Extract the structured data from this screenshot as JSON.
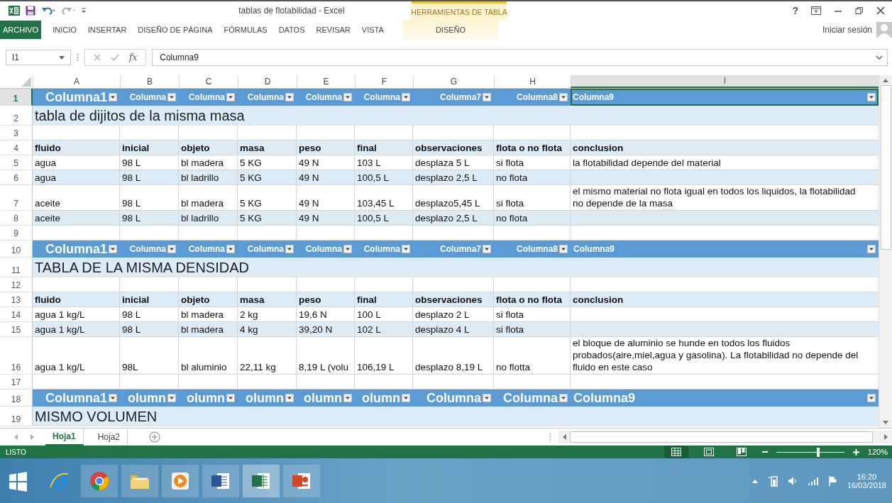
{
  "window": {
    "title": "tablas de flotabilidad - Excel",
    "help": "?"
  },
  "ribbon": {
    "tabs": [
      {
        "label": "ARCHIVO",
        "kind": "file",
        "selected": false
      },
      {
        "label": "INICIO",
        "kind": "tab",
        "selected": false
      },
      {
        "label": "INSERTAR",
        "kind": "tab",
        "selected": false
      },
      {
        "label": "DISEÑO DE PÁGINA",
        "kind": "tab",
        "selected": false
      },
      {
        "label": "FÓRMULAS",
        "kind": "tab",
        "selected": false
      },
      {
        "label": "DATOS",
        "kind": "tab",
        "selected": false
      },
      {
        "label": "REVISAR",
        "kind": "tab",
        "selected": false
      },
      {
        "label": "VISTA",
        "kind": "tab",
        "selected": false
      }
    ],
    "context": {
      "group": "HERRAMIENTAS DE TABLA",
      "tabs": [
        {
          "label": "DISEÑO",
          "selected": false
        }
      ]
    },
    "sign_in": "Iniciar sesión"
  },
  "formula_bar": {
    "name_box": "I1",
    "function_label": "fx",
    "value": "Columna9"
  },
  "columns": [
    {
      "label": "A",
      "selected": false
    },
    {
      "label": "B",
      "selected": false
    },
    {
      "label": "C",
      "selected": false
    },
    {
      "label": "D",
      "selected": false
    },
    {
      "label": "E",
      "selected": false
    },
    {
      "label": "F",
      "selected": false
    },
    {
      "label": "G",
      "selected": false
    },
    {
      "label": "H",
      "selected": false
    },
    {
      "label": "I",
      "selected": true
    }
  ],
  "rows": [
    {
      "number": "1",
      "selected": true,
      "kind": "header",
      "cells": [
        {
          "text": "Columna1",
          "big": true
        },
        {
          "text": "Columna",
          "big": false
        },
        {
          "text": "Columna",
          "big": false
        },
        {
          "text": "Columna",
          "big": false
        },
        {
          "text": "Columna",
          "big": false
        },
        {
          "text": "Columna",
          "big": false
        },
        {
          "text": "Columna7",
          "big": false
        },
        {
          "text": "Columna8",
          "big": false
        },
        {
          "text": "Columna9",
          "big": false
        }
      ]
    },
    {
      "number": "2",
      "selected": false,
      "kind": "title",
      "band": true,
      "text": "tabla de dijitos de la misma masa"
    },
    {
      "number": "3",
      "selected": false,
      "kind": "data",
      "band": false
    },
    {
      "number": "4",
      "selected": false,
      "kind": "data",
      "band": true,
      "bold": true,
      "cells": {
        "A": "fluido",
        "B": "inicial",
        "C": "objeto",
        "D": "masa",
        "E": "peso",
        "F": "final",
        "G": "observaciones",
        "H": "flota o no flota",
        "I": "conclusion"
      }
    },
    {
      "number": "5",
      "selected": false,
      "kind": "data",
      "band": false,
      "bold": false,
      "cells": {
        "A": "agua",
        "B": "98 L",
        "C": "bl madera",
        "D": "5 KG",
        "E": "49 N",
        "F": "103 L",
        "G": "desplaza 5 L",
        "H": "si flota",
        "I": "la flotabilidad depende del material"
      }
    },
    {
      "number": "6",
      "selected": false,
      "kind": "data",
      "band": true,
      "bold": false,
      "cells": {
        "A": "agua",
        "B": "98 L",
        "C": "bl ladrillo",
        "D": "5 KG",
        "E": "49 N",
        "F": "100,5 L",
        "G": "desplazo 2,5 L",
        "H": "no flota"
      }
    },
    {
      "number": "7",
      "selected": false,
      "kind": "data",
      "band": false,
      "bold": false,
      "cells": {
        "A": "aceite",
        "B": "98 L",
        "C": "bl madera",
        "D": "5 KG",
        "E": "49 N",
        "F": "103,45 L",
        "G": "desplazo5,45 L",
        "H": "si flota",
        "I": "el mismo material no flota igual en todos los liquidos, la flotabilidad no depende de la masa"
      }
    },
    {
      "number": "8",
      "selected": false,
      "kind": "data",
      "band": true,
      "bold": false,
      "cells": {
        "A": "aceite",
        "B": "98 L",
        "C": "bl ladrillo",
        "D": "5 KG",
        "E": "49 N",
        "F": "100,5 L",
        "G": "desplazo 2,5 L",
        "H": "no flota"
      }
    },
    {
      "number": "9",
      "selected": false,
      "kind": "data",
      "band": false
    },
    {
      "number": "10",
      "selected": false,
      "kind": "header",
      "cells": [
        {
          "text": "Columna1",
          "big": true
        },
        {
          "text": "Columna",
          "big": false
        },
        {
          "text": "Columna",
          "big": false
        },
        {
          "text": "Columna",
          "big": false
        },
        {
          "text": "Columna",
          "big": false
        },
        {
          "text": "Columna",
          "big": false
        },
        {
          "text": "Columna7",
          "big": false
        },
        {
          "text": "Columna8",
          "big": false
        },
        {
          "text": "Columna9",
          "big": false
        }
      ]
    },
    {
      "number": "11",
      "selected": false,
      "kind": "title",
      "band": true,
      "text": "TABLA DE LA MISMA DENSIDAD"
    },
    {
      "number": "12",
      "selected": false,
      "kind": "data",
      "band": false
    },
    {
      "number": "13",
      "selected": false,
      "kind": "data",
      "band": true,
      "bold": true,
      "cells": {
        "A": "fluido",
        "B": "inicial",
        "C": "objeto",
        "D": "masa",
        "E": "peso",
        "F": "final",
        "G": "observaciones",
        "H": "flota o no flota",
        "I": "conclusion"
      }
    },
    {
      "number": "14",
      "selected": false,
      "kind": "data",
      "band": false,
      "bold": false,
      "cells": {
        "A": "agua 1 kg/L",
        "B": "98 L",
        "C": "bl madera",
        "D": "2 kg",
        "E": "19,6 N",
        "F": "100 L",
        "G": "desplazo 2 L",
        "H": "si flota"
      }
    },
    {
      "number": "15",
      "selected": false,
      "kind": "data",
      "band": true,
      "bold": false,
      "cells": {
        "A": "agua 1 kg/L",
        "B": "98 L",
        "C": "bl madera",
        "D": "4 kg",
        "E": "39,20 N",
        "F": "102 L",
        "G": "desplazo 4 L",
        "H": "si flota"
      }
    },
    {
      "number": "16",
      "selected": false,
      "kind": "data",
      "band": false,
      "bold": false,
      "cells": {
        "A": "agua 1 kg/L",
        "B": "98L",
        "C": "bl aluminio",
        "D": "22,11 kg",
        "E": "8,19 L (volu",
        "F": "106,19 L",
        "G": "desplazo 8,19 L",
        "H": "no flotta",
        "I": "el bloque de aluminio se hunde en todos los fluidos probados(aire,miel,agua y gasolina). La flotabilidad no depende del fluido en este caso"
      }
    },
    {
      "number": "17",
      "selected": false,
      "kind": "data",
      "band": false
    },
    {
      "number": "18",
      "selected": false,
      "kind": "header",
      "cells": [
        {
          "text": "Columna1",
          "big": true
        },
        {
          "text": "olumn",
          "big": true
        },
        {
          "text": "olumn",
          "big": true
        },
        {
          "text": "olumn",
          "big": true
        },
        {
          "text": "olumn",
          "big": true
        },
        {
          "text": "olumn",
          "big": true
        },
        {
          "text": "Columna",
          "big": true
        },
        {
          "text": "Columna",
          "big": true
        },
        {
          "text": "Columna9",
          "big": true
        }
      ]
    },
    {
      "number": "19",
      "selected": false,
      "kind": "title",
      "band": true,
      "text": "MISMO VOLUMEN"
    }
  ],
  "sheet_tabs": [
    {
      "label": "Hoja1",
      "selected": true
    },
    {
      "label": "Hoja2",
      "selected": false
    }
  ],
  "status_bar": {
    "status": "LISTO",
    "views": [
      {
        "kind": "normal",
        "selected": true
      },
      {
        "kind": "layout",
        "selected": false
      },
      {
        "kind": "page_break",
        "selected": false
      }
    ],
    "zoom": {
      "level": 0.62,
      "reading": "120%"
    }
  },
  "taskbar": {
    "apps": [
      {
        "kind": "start",
        "open": false,
        "active": false
      },
      {
        "kind": "ie",
        "open": false,
        "active": false
      },
      {
        "kind": "chrome",
        "open": true,
        "active": false
      },
      {
        "kind": "folder",
        "open": true,
        "active": false
      },
      {
        "kind": "media",
        "open": true,
        "active": false
      },
      {
        "kind": "word",
        "open": true,
        "active": false
      },
      {
        "kind": "excel",
        "open": true,
        "active": true
      },
      {
        "kind": "powerpoint",
        "open": true,
        "active": false
      }
    ],
    "time": "16:20",
    "date": "16/03/2018"
  }
}
